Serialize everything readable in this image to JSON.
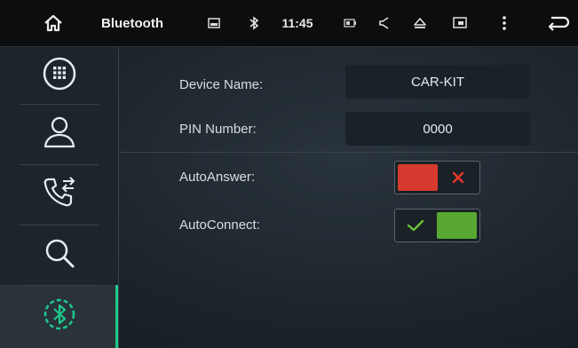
{
  "status_bar": {
    "title": "Bluetooth",
    "time": "11:45",
    "icons": [
      "home-icon",
      "image-icon",
      "bluetooth-icon",
      "battery-icon",
      "volume-icon",
      "eject-icon",
      "picture-in-picture-icon",
      "more-vert-icon",
      "back-icon"
    ]
  },
  "sidebar": {
    "items": [
      {
        "icon": "dialpad-icon",
        "active": false
      },
      {
        "icon": "contacts-icon",
        "active": false
      },
      {
        "icon": "call-log-icon",
        "active": false
      },
      {
        "icon": "search-icon",
        "active": false
      },
      {
        "icon": "bluetooth-music-icon",
        "active": true
      }
    ]
  },
  "settings": {
    "device_name": {
      "label": "Device Name:",
      "value": "CAR-KIT"
    },
    "pin_number": {
      "label": "PIN Number:",
      "value": "0000"
    },
    "auto_answer": {
      "label": "AutoAnswer:",
      "state": "off"
    },
    "auto_connect": {
      "label": "AutoConnect:",
      "state": "on"
    }
  },
  "colors": {
    "accent": "#1ec98c",
    "toggle_off": "#d63a2e",
    "toggle_on": "#58a832"
  }
}
